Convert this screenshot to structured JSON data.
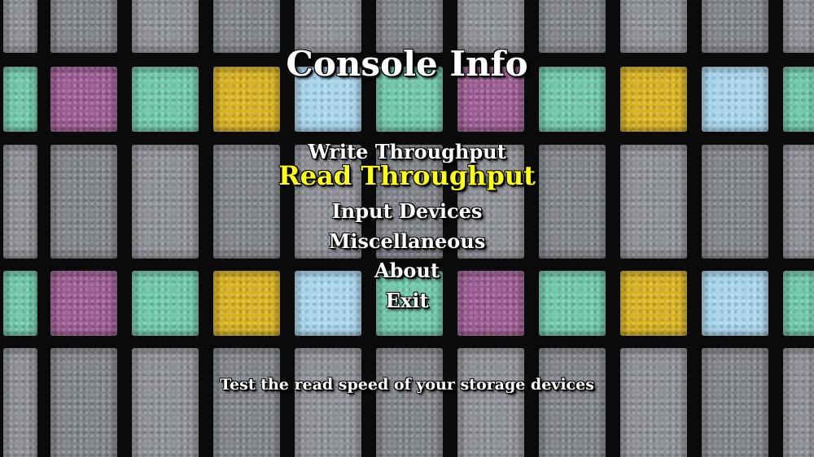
{
  "title": "Console Info",
  "menu": {
    "items": [
      {
        "label": "Write Throughput",
        "selected": false
      },
      {
        "label": "Read Throughput",
        "selected": true
      },
      {
        "label": "Input Devices",
        "selected": false
      },
      {
        "label": "Miscellaneous",
        "selected": false
      },
      {
        "label": "About",
        "selected": false
      },
      {
        "label": "Exit",
        "selected": false
      }
    ]
  },
  "description": "Test the read speed of your storage devices",
  "colors": {
    "text": "#ffffff",
    "selected": "#ffff1a",
    "tile_grey": "#8c8f95",
    "tile_teal": "#6fc9a9",
    "tile_purple": "#9c5b92",
    "tile_yellow": "#d9b21f",
    "tile_blue": "#a8d6ee"
  }
}
